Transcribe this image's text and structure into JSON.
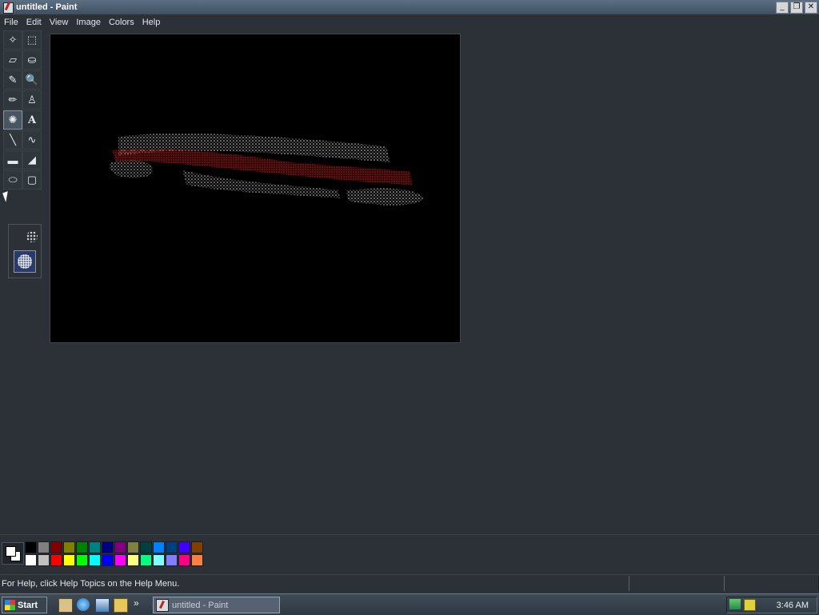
{
  "window": {
    "title": "untitled - Paint",
    "controls": {
      "minimize": "_",
      "restore": "❐",
      "close": "✕"
    }
  },
  "menu": [
    "File",
    "Edit",
    "View",
    "Image",
    "Colors",
    "Help"
  ],
  "toolbox": {
    "tools": [
      {
        "name": "free-form-select-icon",
        "glyph": "✧"
      },
      {
        "name": "select-icon",
        "glyph": "⬚"
      },
      {
        "name": "eraser-icon",
        "glyph": "▱"
      },
      {
        "name": "fill-bucket-icon",
        "glyph": "⛀"
      },
      {
        "name": "pick-color-icon",
        "glyph": "✎"
      },
      {
        "name": "magnifier-icon",
        "glyph": "🔍"
      },
      {
        "name": "pencil-icon",
        "glyph": "✏"
      },
      {
        "name": "brush-icon",
        "glyph": "♙"
      },
      {
        "name": "airbrush-icon",
        "glyph": "✺",
        "active": true
      },
      {
        "name": "text-icon",
        "glyph": "A"
      },
      {
        "name": "line-icon",
        "glyph": "╲"
      },
      {
        "name": "curve-icon",
        "glyph": "∿"
      },
      {
        "name": "rectangle-icon",
        "glyph": "▬"
      },
      {
        "name": "polygon-icon",
        "glyph": "◢"
      },
      {
        "name": "ellipse-icon",
        "glyph": "⬭"
      },
      {
        "name": "rounded-rectangle-icon",
        "glyph": "▢"
      }
    ]
  },
  "palette": {
    "foreground": "#ffffff",
    "background": "#ffffff",
    "row1": [
      "#000000",
      "#808080",
      "#800000",
      "#808000",
      "#008000",
      "#008080",
      "#000080",
      "#800080",
      "#808040",
      "#004040",
      "#0080ff",
      "#004080",
      "#4000ff",
      "#804000"
    ],
    "row2": [
      "#ffffff",
      "#c0c0c0",
      "#ff0000",
      "#ffff00",
      "#00ff00",
      "#00ffff",
      "#0000ff",
      "#ff00ff",
      "#ffff80",
      "#00ff80",
      "#80ffff",
      "#8080ff",
      "#ff0080",
      "#ff8040"
    ]
  },
  "status": {
    "help_text": "For Help, click Help Topics on the Help Menu."
  },
  "taskbar": {
    "start_label": "Start",
    "chevron": "»",
    "task_label": "untitled - Paint",
    "clock": "3:46 AM"
  }
}
